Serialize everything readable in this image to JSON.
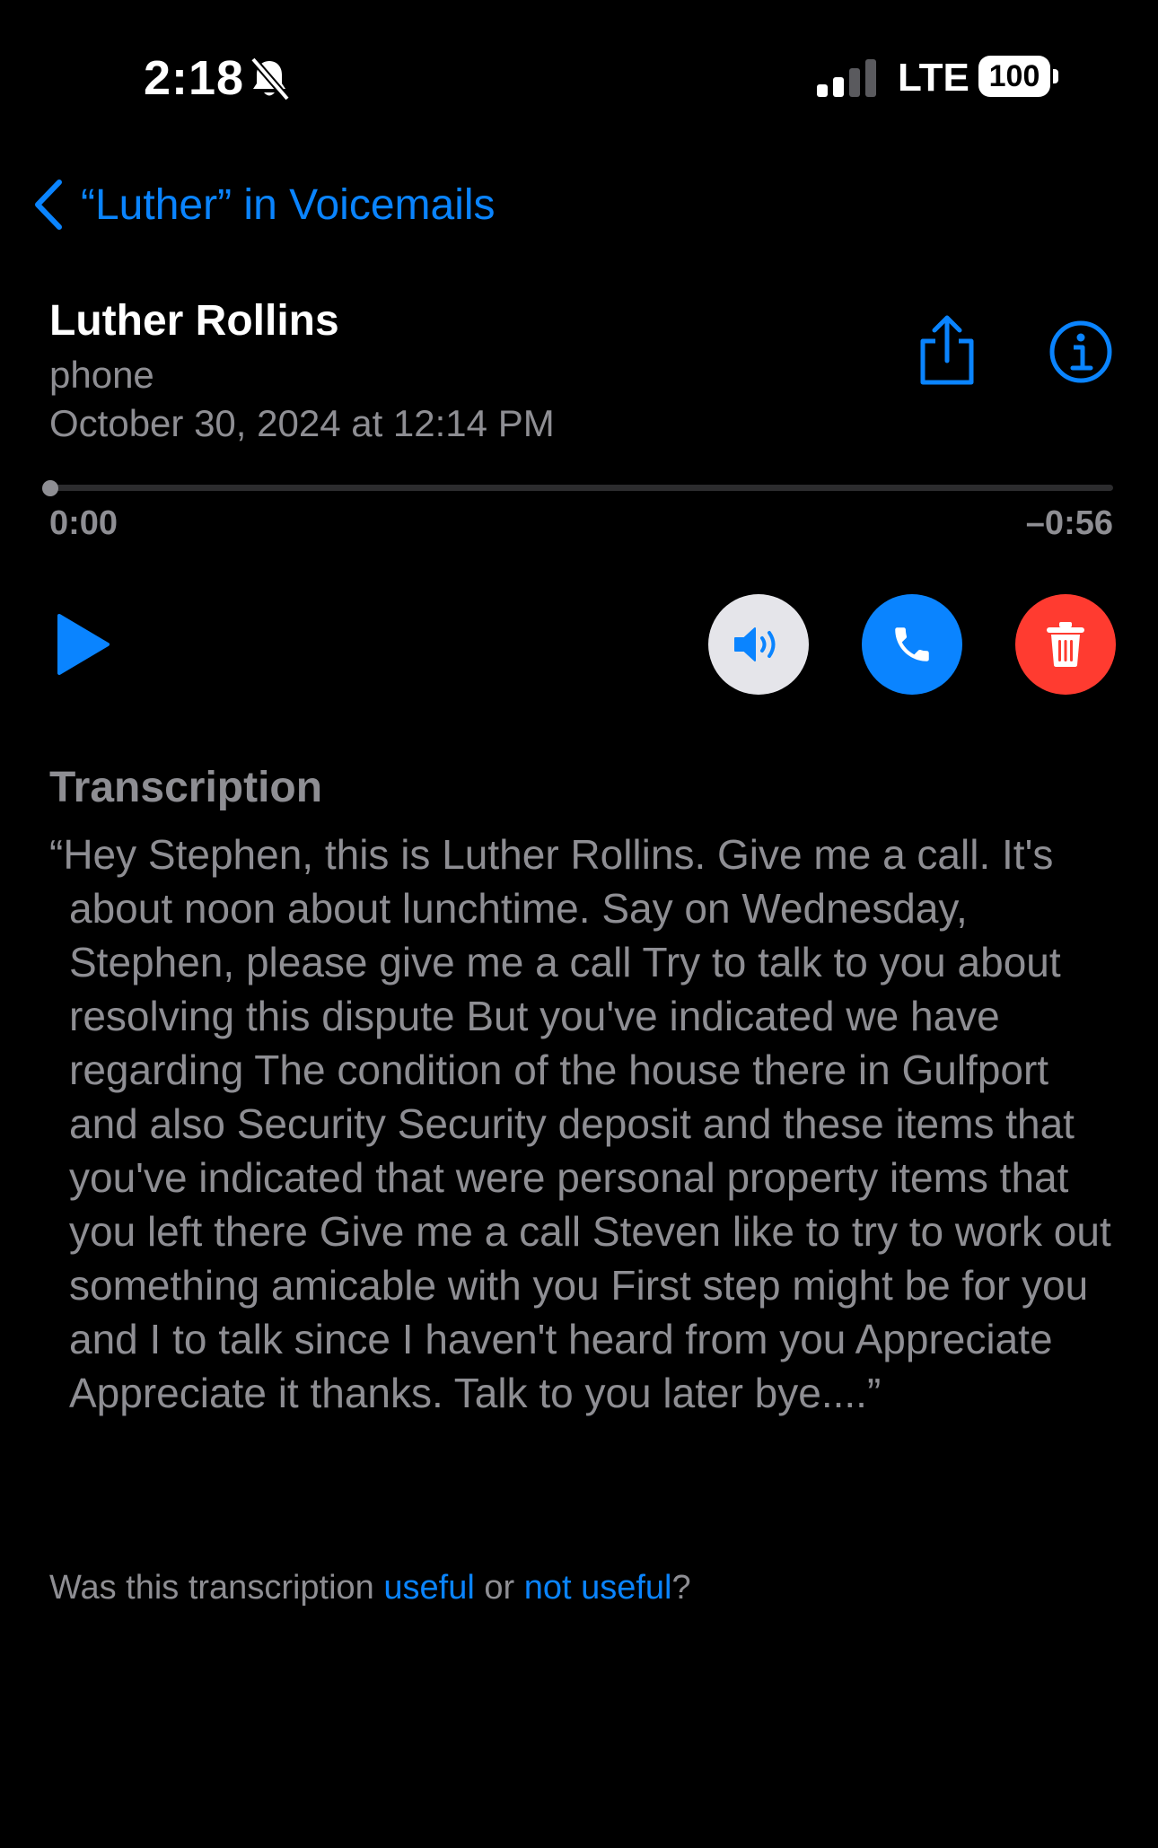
{
  "status_bar": {
    "time": "2:18",
    "network": "LTE",
    "battery": "100"
  },
  "nav": {
    "back_label": "“Luther” in Voicemails"
  },
  "voicemail": {
    "caller": "Luther Rollins",
    "label": "phone",
    "date": "October 30, 2024 at 12:14 PM",
    "elapsed": "0:00",
    "remaining": "–0:56",
    "progress": 0
  },
  "transcription": {
    "heading": "Transcription",
    "text": "“Hey Stephen, this is Luther Rollins. Give me a call. It's about noon about lunchtime. Say on Wednesday, Stephen, please give me a call Try to talk to you about resolving this dispute But you've indicated we have regarding The condition of the house there in Gulfport and also Security Security deposit and these items that you've indicated that were personal property items that you left there Give me a call Steven like to try to work out something amicable with you First step might be for you and I to talk since I haven't heard from you Appreciate Appreciate it thanks. Talk to you later bye....”",
    "feedback_prefix": "Was this transcription ",
    "useful": "useful",
    "or": " or ",
    "not_useful": "not useful",
    "suffix": "?"
  },
  "icons": {
    "silent": "bell-slash-icon",
    "share": "share-icon",
    "info": "info-icon",
    "play": "play-icon",
    "speaker": "speaker-icon",
    "call": "phone-icon",
    "delete": "trash-icon"
  },
  "colors": {
    "accent": "#0a84ff",
    "delete": "#ff3b30",
    "secondary_text": "#8e8e93"
  }
}
